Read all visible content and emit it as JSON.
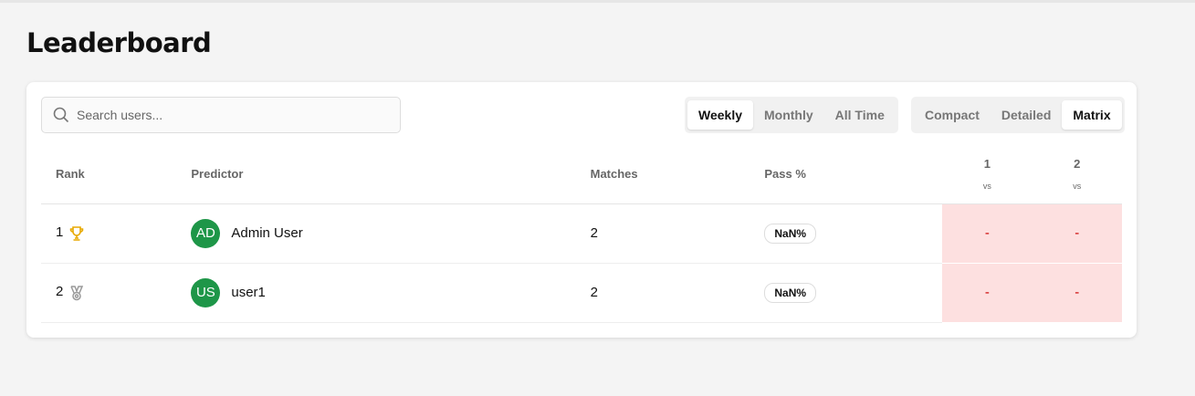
{
  "page": {
    "title": "Leaderboard"
  },
  "search": {
    "placeholder": "Search users..."
  },
  "period_tabs": [
    {
      "label": "Weekly",
      "active": true
    },
    {
      "label": "Monthly",
      "active": false
    },
    {
      "label": "All Time",
      "active": false
    }
  ],
  "view_tabs": [
    {
      "label": "Compact",
      "active": false
    },
    {
      "label": "Detailed",
      "active": false
    },
    {
      "label": "Matrix",
      "active": true
    }
  ],
  "columns": {
    "rank": "Rank",
    "predictor": "Predictor",
    "matches": "Matches",
    "pass": "Pass %",
    "m1": "1",
    "m2": "2",
    "vs": "vs"
  },
  "rows": [
    {
      "rank": "1",
      "icon": "trophy-icon",
      "initials": "AD",
      "name": "Admin User",
      "matches": "2",
      "pass": "NaN%",
      "c1": "-",
      "c2": "-"
    },
    {
      "rank": "2",
      "icon": "medal-icon",
      "initials": "US",
      "name": "user1",
      "matches": "2",
      "pass": "NaN%",
      "c1": "-",
      "c2": "-"
    }
  ],
  "colors": {
    "avatar": "#1e9648",
    "trophy": "#e8a900",
    "matrix_cell": "#fde0e0"
  }
}
